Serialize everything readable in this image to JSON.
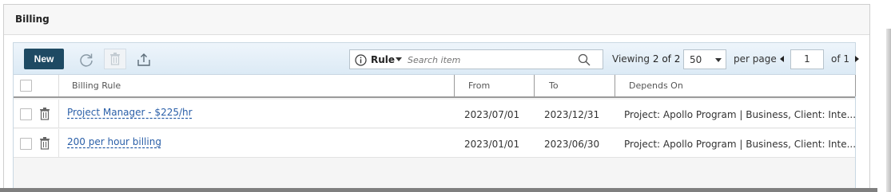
{
  "panel": {
    "title": "Billing"
  },
  "toolbar": {
    "new_label": "New",
    "search": {
      "field": "Rule",
      "placeholder": "Search item"
    },
    "viewing_label": "Viewing",
    "viewing_count": "2 of 2",
    "page_size": "50",
    "per_page_label": "per page",
    "current_page": "1",
    "of_pages": "of 1"
  },
  "columns": [
    "Billing Rule",
    "From",
    "To",
    "Depends On"
  ],
  "rows": [
    {
      "rule": "Project Manager - $225/hr",
      "from": "2023/07/01",
      "to": "2023/12/31",
      "depends": "Project: Apollo Program | Business, Client: Inte..."
    },
    {
      "rule": "200 per hour billing",
      "from": "2023/01/01",
      "to": "2023/06/30",
      "depends": "Project: Apollo Program | Business, Client: Inte..."
    }
  ],
  "colors": {
    "primary_button": "#1e4a63",
    "link": "#2a5fa8",
    "toolbar_bg": "#dceaf5"
  },
  "icons": [
    "refresh-icon",
    "trash-icon",
    "export-icon",
    "info-icon",
    "search-icon",
    "chevron-down-icon"
  ]
}
